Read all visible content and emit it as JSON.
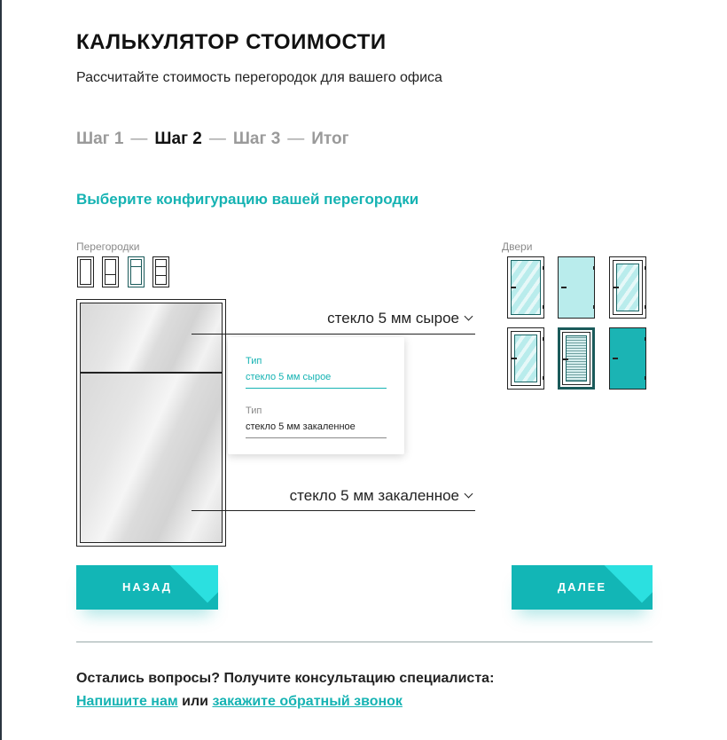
{
  "header": {
    "title": "КАЛЬКУЛЯТОР СТОИМОСТИ",
    "subtitle": "Рассчитайте стоимость перегородок для вашего офиса"
  },
  "steps": {
    "step1": "Шаг 1",
    "step2": "Шаг 2",
    "step3": "Шаг 3",
    "final": "Итог",
    "separator": "—",
    "current": "Шаг 2"
  },
  "config": {
    "section_title": "Выберите конфигурацию вашей перегородки",
    "partitions_label": "Перегородки",
    "doors_label": "Двери",
    "top_pane_glass": "стекло 5 мм сырое",
    "bottom_pane_glass": "стекло 5 мм закаленное",
    "selected_partition_icon": 3,
    "selected_door": 5
  },
  "popup": {
    "option1_label": "Тип",
    "option1_value": "стекло 5 мм сырое",
    "option2_label": "Тип",
    "option2_value": "стекло 5 мм закаленное",
    "active_option": 1
  },
  "buttons": {
    "back": "НАЗАД",
    "next": "ДАЛЕЕ"
  },
  "footer": {
    "question": "Остались вопросы? Получите консультацию специалиста:",
    "link_write": "Напишите нам",
    "or": "или",
    "link_callback": "закажите обратный звонок"
  },
  "colors": {
    "accent": "#16b3b3",
    "button": "#12b6b6",
    "text": "#222222"
  }
}
